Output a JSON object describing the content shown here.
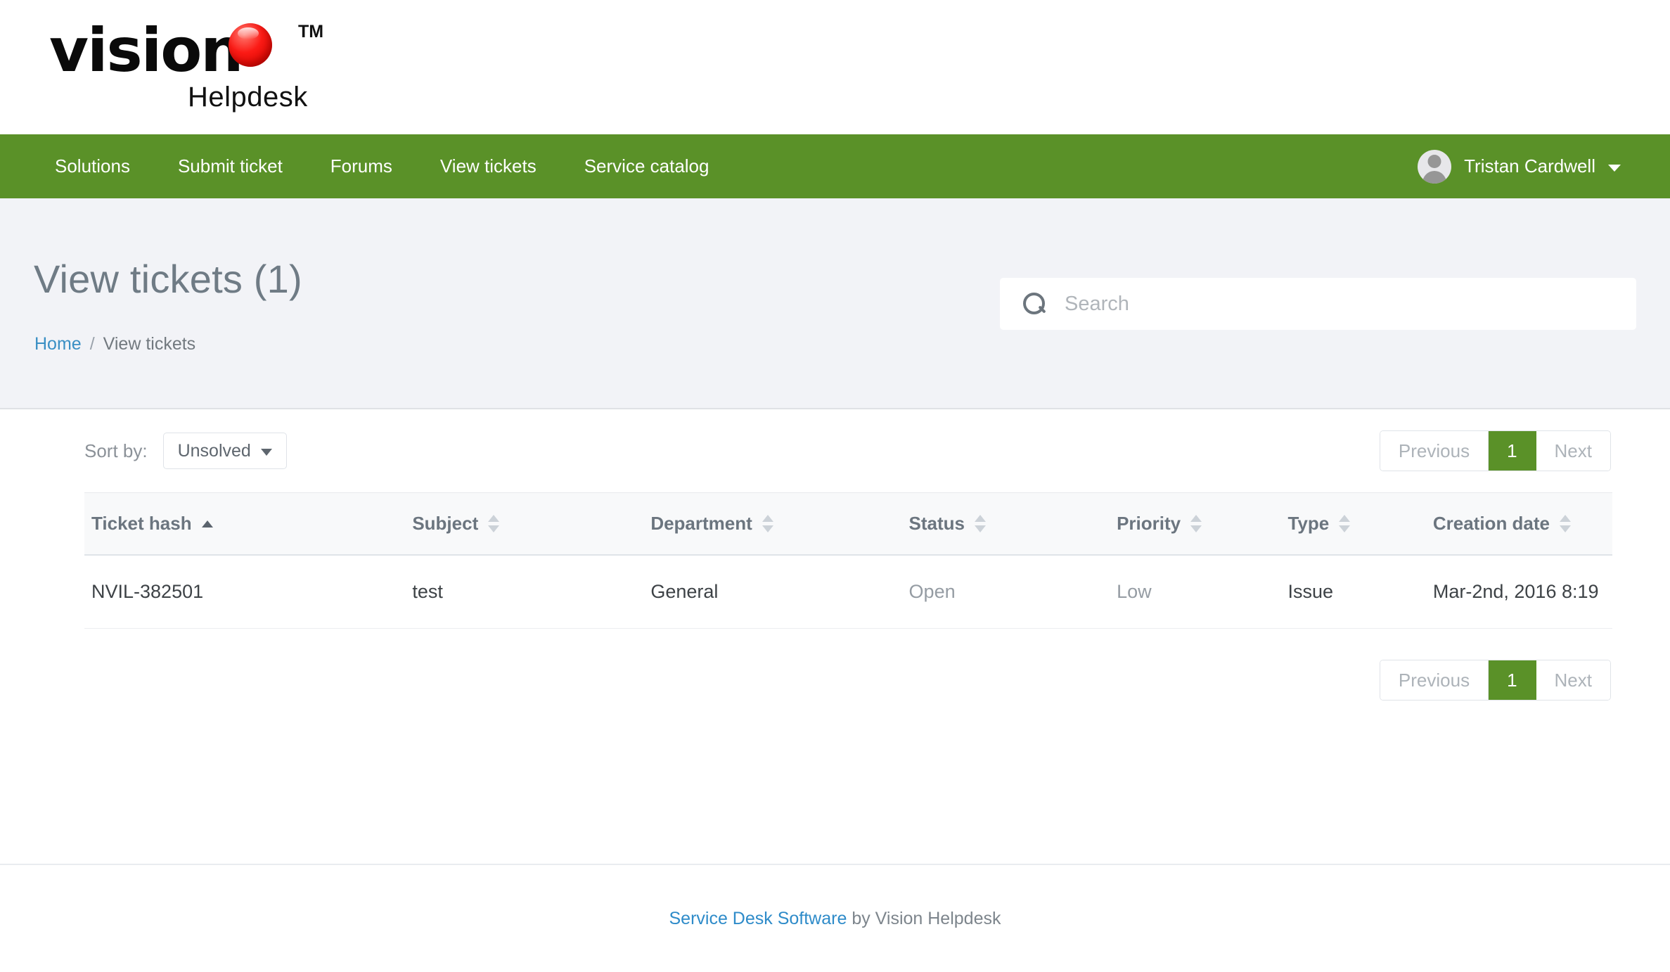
{
  "brand": {
    "logo_word": "vision",
    "logo_tm": "TM",
    "logo_sub": "Helpdesk",
    "accent_green": "#5a9128",
    "link_blue": "#2e8bc9",
    "logo_red": "#fb1b16"
  },
  "nav": {
    "items": [
      {
        "label": "Solutions",
        "name": "nav-link-solutions"
      },
      {
        "label": "Submit ticket",
        "name": "nav-link-submit-ticket"
      },
      {
        "label": "Forums",
        "name": "nav-link-forums"
      },
      {
        "label": "View tickets",
        "name": "nav-link-view-tickets"
      },
      {
        "label": "Service catalog",
        "name": "nav-link-service-catalog"
      }
    ],
    "user": {
      "name": "Tristan Cardwell",
      "avatar_icon": "user-avatar-icon",
      "caret_icon": "chevron-down-icon"
    }
  },
  "hero": {
    "title": "View tickets (1)",
    "breadcrumb": {
      "home": "Home",
      "separator": "/",
      "current": "View tickets"
    },
    "search": {
      "placeholder": "Search",
      "value": "",
      "icon": "search-icon"
    }
  },
  "toolbar": {
    "sort_label": "Sort by:",
    "sort_value": "Unsolved",
    "sort_options": [
      "Unsolved"
    ]
  },
  "pagination": {
    "previous": "Previous",
    "page": "1",
    "next": "Next"
  },
  "table": {
    "columns": [
      {
        "label": "Ticket hash",
        "sort": "asc"
      },
      {
        "label": "Subject",
        "sort": "none"
      },
      {
        "label": "Department",
        "sort": "none"
      },
      {
        "label": "Status",
        "sort": "none"
      },
      {
        "label": "Priority",
        "sort": "none"
      },
      {
        "label": "Type",
        "sort": "none"
      },
      {
        "label": "Creation date",
        "sort": "none"
      }
    ],
    "rows": [
      {
        "ticket_hash": "NVIL-382501",
        "subject": "test",
        "department": "General",
        "status": "Open",
        "priority": "Low",
        "type": "Issue",
        "creation_date": "Mar-2nd, 2016 8:19"
      }
    ]
  },
  "footer": {
    "link": "Service Desk Software",
    "suffix": " by Vision Helpdesk"
  }
}
